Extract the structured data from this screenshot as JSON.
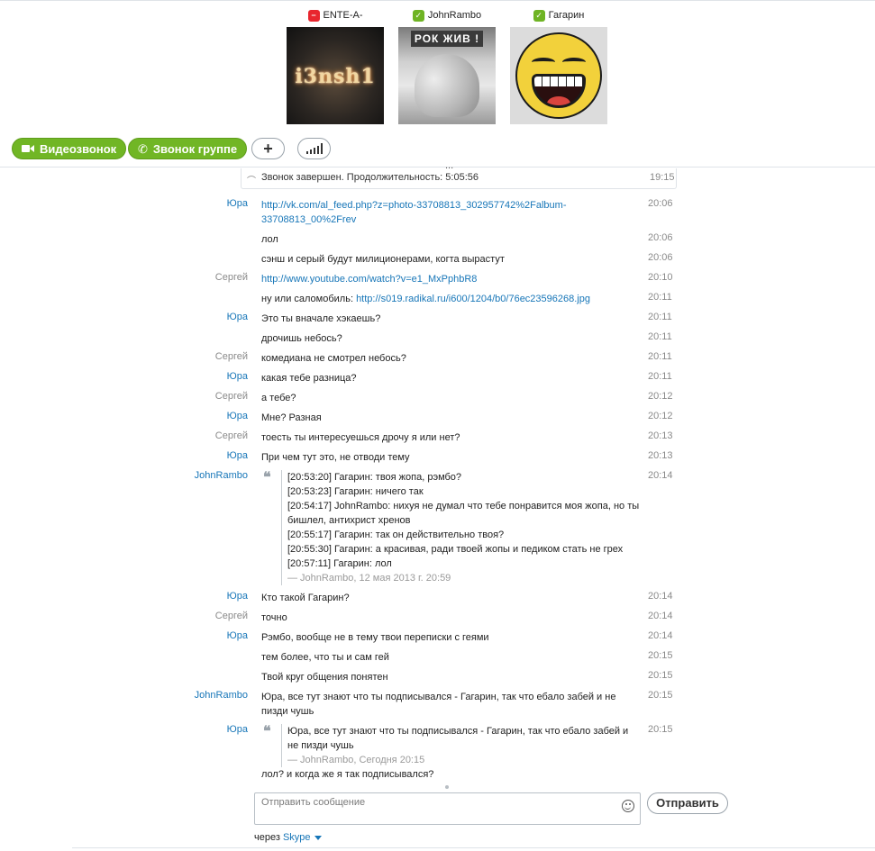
{
  "participants": [
    {
      "name": "ENTE-A-",
      "status": "dnd",
      "avatar_text": "i3nsh1"
    },
    {
      "name": "JohnRambo",
      "status": "online",
      "avatar_text": "РОК ЖИВ !"
    },
    {
      "name": "Гагарин",
      "status": "online",
      "avatar_text": ""
    }
  ],
  "toolbar": {
    "video_call": "Видеозвонок",
    "group_call": "Звонок группе",
    "more": "..."
  },
  "call_ended": {
    "text": "Звонок завершен. Продолжительность: 5:05:56",
    "time": "19:15"
  },
  "messages": [
    {
      "sender": "Юра",
      "text_parts": [
        {
          "t": "http://vk.com/al_feed.php?z=photo-33708813_302957742%2Falbum-33708813_00%2Frev",
          "link": true
        }
      ],
      "time": "20:06"
    },
    {
      "sender": "",
      "text_parts": [
        {
          "t": "лол",
          "link": false
        }
      ],
      "time": "20:06"
    },
    {
      "sender": "",
      "text_parts": [
        {
          "t": "сэнш и серый будут милиционерами, когта вырастут",
          "link": false
        }
      ],
      "time": "20:06"
    },
    {
      "sender": "Сергей",
      "text_parts": [
        {
          "t": "http://www.youtube.com/watch?v=e1_MxPphbR8",
          "link": true
        }
      ],
      "time": "20:10"
    },
    {
      "sender": "",
      "text_parts": [
        {
          "t": "ну или саломобиль: ",
          "link": false
        },
        {
          "t": "http://s019.radikal.ru/i600/1204/b0/76ec23596268.jpg",
          "link": true
        }
      ],
      "time": "20:11"
    },
    {
      "sender": "Юра",
      "text_parts": [
        {
          "t": "Это ты вначале хэкаешь?",
          "link": false
        }
      ],
      "time": "20:11"
    },
    {
      "sender": "",
      "text_parts": [
        {
          "t": "дрочишь небось?",
          "link": false
        }
      ],
      "time": "20:11"
    },
    {
      "sender": "Сергей",
      "text_parts": [
        {
          "t": "комедиана не смотрел небось?",
          "link": false
        }
      ],
      "time": "20:11"
    },
    {
      "sender": "Юра",
      "text_parts": [
        {
          "t": "какая тебе разница?",
          "link": false
        }
      ],
      "time": "20:11"
    },
    {
      "sender": "Сергей",
      "text_parts": [
        {
          "t": "а тебе?",
          "link": false
        }
      ],
      "time": "20:12"
    },
    {
      "sender": "Юра",
      "text_parts": [
        {
          "t": "Мне? Разная",
          "link": false
        }
      ],
      "time": "20:12"
    },
    {
      "sender": "Сергей",
      "text_parts": [
        {
          "t": "тоесть ты интересуешься дрочу я или нет?",
          "link": false
        }
      ],
      "time": "20:13"
    },
    {
      "sender": "Юра",
      "text_parts": [
        {
          "t": "При чем тут это, не отводи тему",
          "link": false
        }
      ],
      "time": "20:13"
    }
  ],
  "quote1": {
    "sender": "JohnRambo",
    "time": "20:14",
    "lines": [
      "[20:53:20] Гагарин: твоя жопа, рэмбо?",
      "[20:53:23] Гагарин: ничего так",
      "[20:54:17] JohnRambo: нихуя не думал что тебе понравится моя жопа, но ты бишлел, антихрист хренов",
      "[20:55:17] Гагарин: так он действительно твоя?",
      "[20:55:30] Гагарин: а красивая, ради твоей жопы и педиком стать не грех",
      "[20:57:11] Гагарин: лол"
    ],
    "signature": "— JohnRambo, 12 мая 2013 г. 20:59"
  },
  "messages2": [
    {
      "sender": "Юра",
      "text": "Кто такой Гагарин?",
      "time": "20:14"
    },
    {
      "sender": "Сергей",
      "text": "точно",
      "time": "20:14"
    },
    {
      "sender": "Юра",
      "text": "Рэмбо, вообще не в тему твои переписки с геями",
      "time": "20:14"
    },
    {
      "sender": "",
      "text": "тем более, что ты и сам гей",
      "time": "20:15"
    },
    {
      "sender": "",
      "text": "Твой круг общения понятен",
      "time": "20:15"
    },
    {
      "sender": "JohnRambo",
      "text": "Юра, все тут знают что ты подписывался - Гагарин, так что ебало забей и не пизди чушь",
      "time": "20:15"
    }
  ],
  "quote2": {
    "sender": "Юра",
    "time": "20:15",
    "text": "Юра, все тут знают что ты подписывался - Гагарин, так что ебало забей и не пизди чушь",
    "signature": "— JohnRambo, Сегодня 20:15"
  },
  "last_message": {
    "sender": "",
    "text": "лол? и когда же я так подписывался?",
    "time": ""
  },
  "composer": {
    "placeholder": "Отправить сообщение",
    "send_label": "Отправить",
    "via_prefix": "через",
    "via_service": "Skype"
  },
  "colors": {
    "accent_green": "#71b625",
    "link_blue": "#1776b8",
    "dnd_red": "#e8262e"
  }
}
